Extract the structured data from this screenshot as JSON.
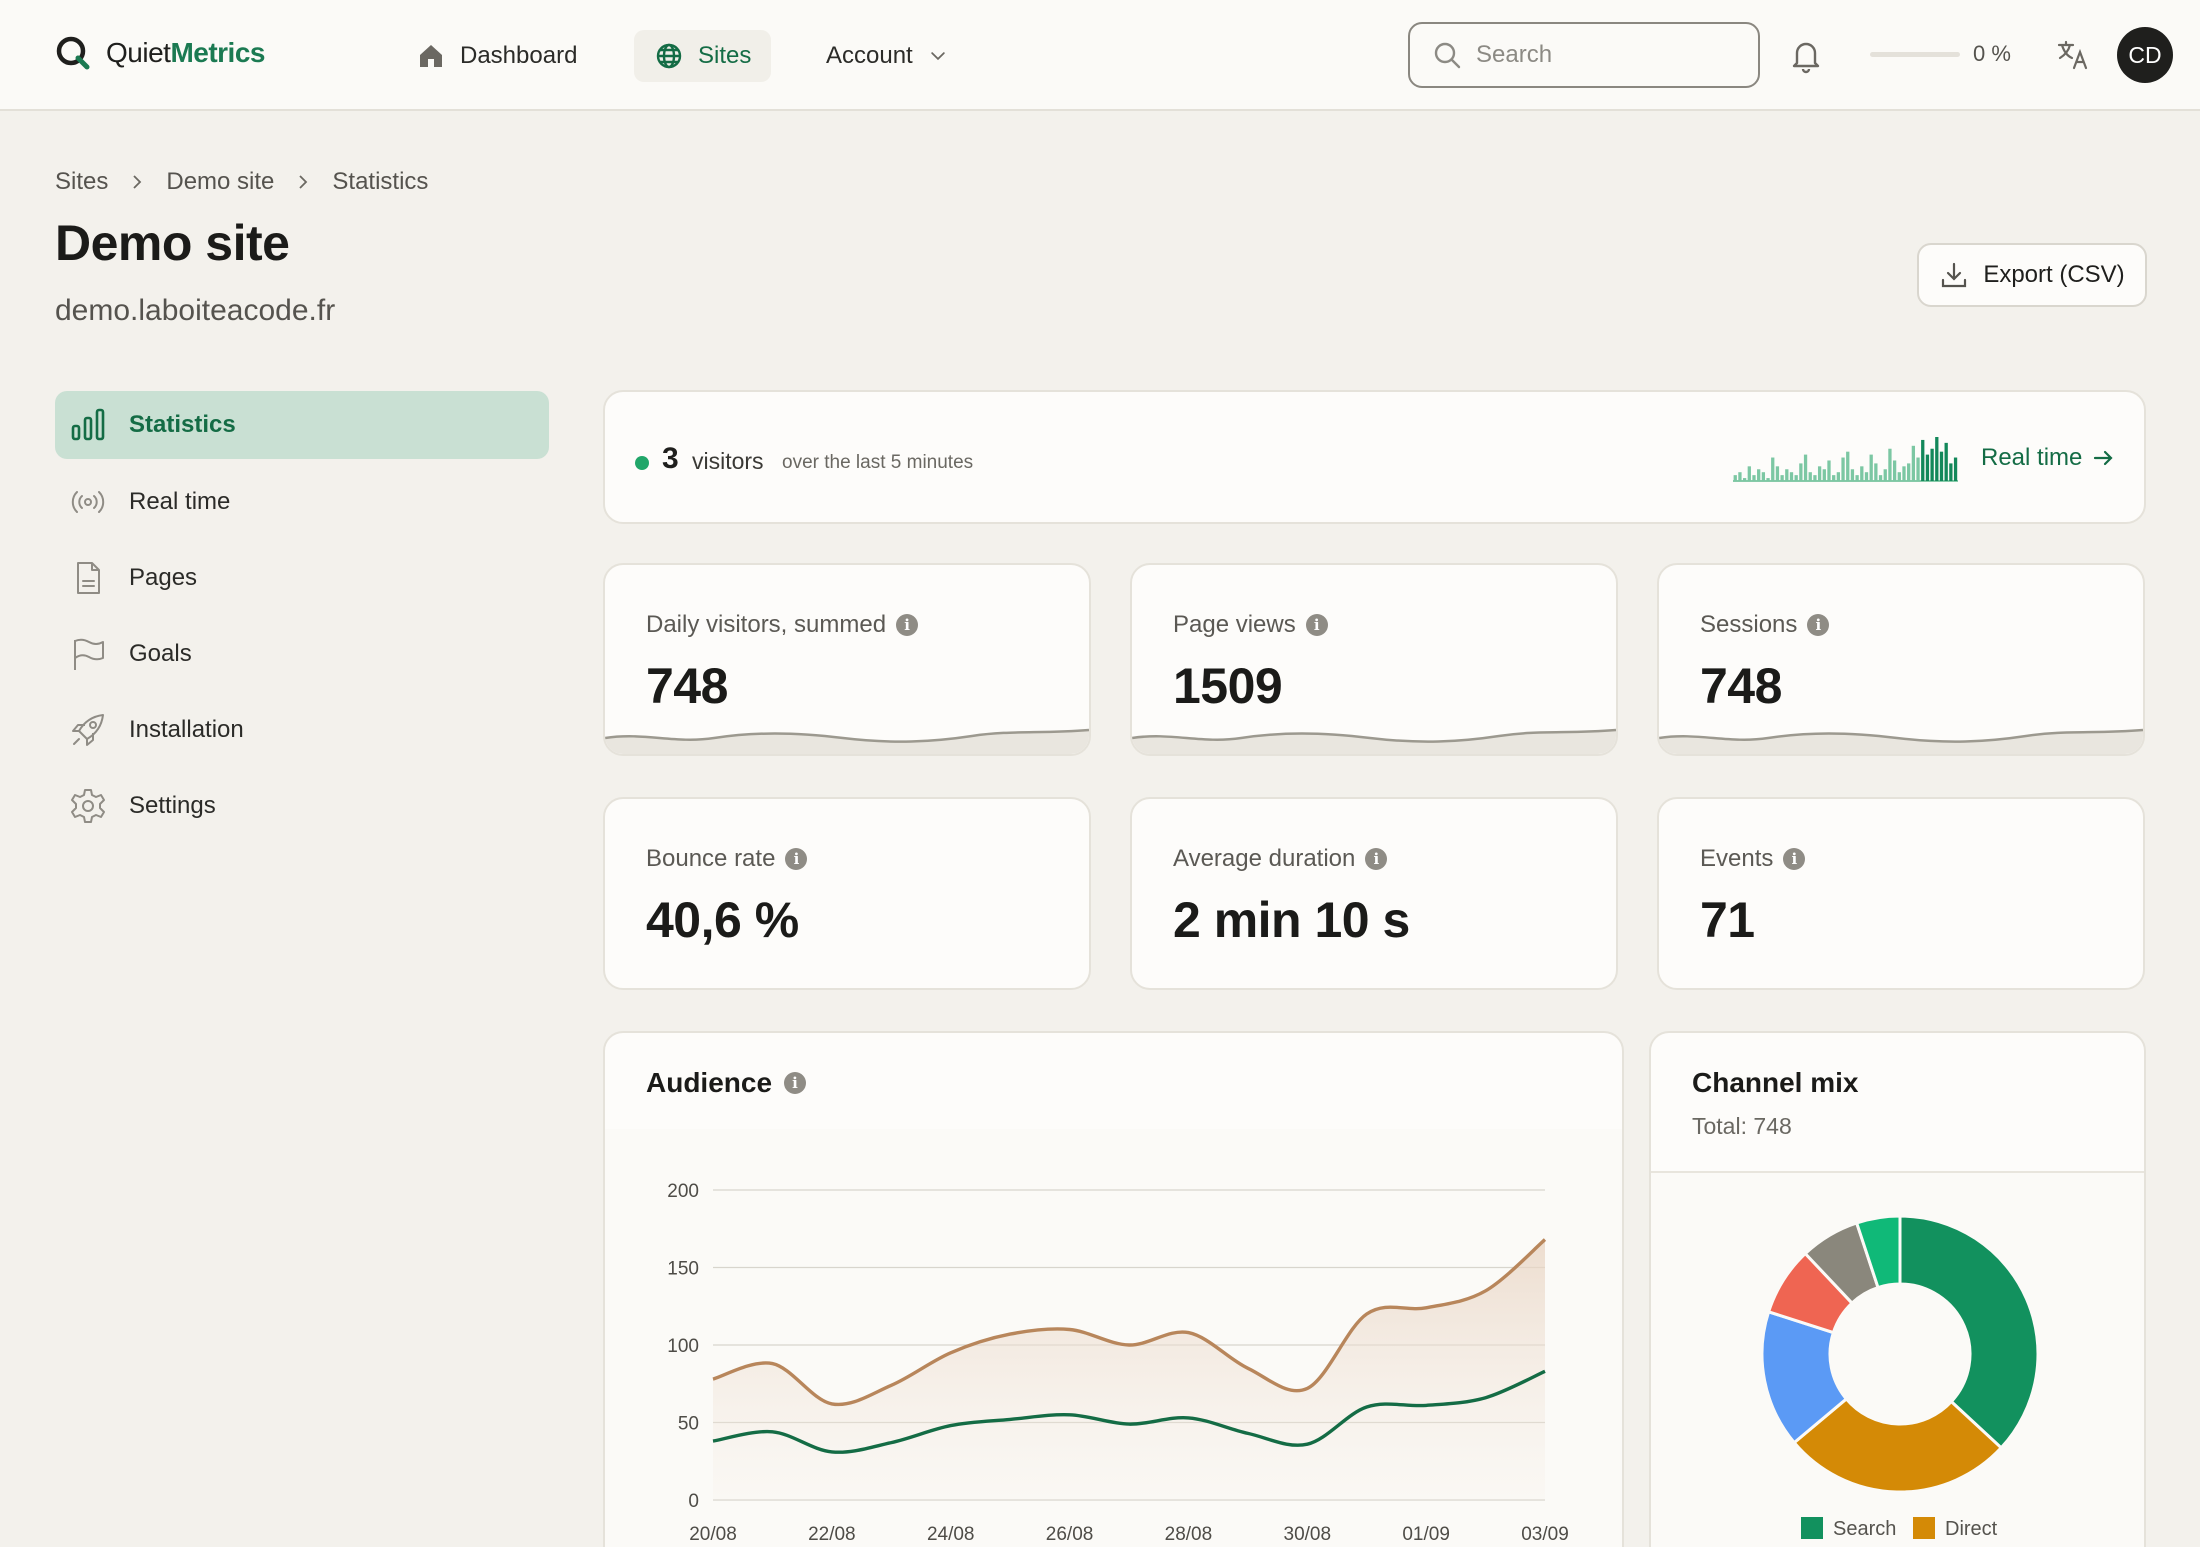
{
  "brand": {
    "name_part1": "Quiet",
    "name_part2": "Metrics",
    "accent": "#1b7a52"
  },
  "nav": {
    "dashboard": "Dashboard",
    "sites": "Sites",
    "account": "Account"
  },
  "search": {
    "placeholder": "Search"
  },
  "usage": {
    "percent": 0,
    "label": "0 %"
  },
  "user": {
    "initials": "CD"
  },
  "breadcrumb": [
    "Sites",
    "Demo site",
    "Statistics"
  ],
  "page": {
    "title": "Demo site",
    "domain": "demo.laboiteacode.fr"
  },
  "actions": {
    "export": "Export (CSV)"
  },
  "sidebar": [
    {
      "label": "Statistics",
      "icon": "bar-chart-icon",
      "active": true
    },
    {
      "label": "Real time",
      "icon": "broadcast-icon",
      "active": false
    },
    {
      "label": "Pages",
      "icon": "document-icon",
      "active": false
    },
    {
      "label": "Goals",
      "icon": "flag-icon",
      "active": false
    },
    {
      "label": "Installation",
      "icon": "rocket-icon",
      "active": false
    },
    {
      "label": "Settings",
      "icon": "gear-icon",
      "active": false
    }
  ],
  "realtime": {
    "count": "3",
    "label": "visitors",
    "sub": "over the last 5 minutes",
    "link": "Real time",
    "bars": [
      2,
      3,
      1,
      5,
      2,
      4,
      3,
      1,
      8,
      5,
      2,
      4,
      3,
      2,
      6,
      9,
      3,
      2,
      5,
      4,
      7,
      2,
      3,
      8,
      10,
      4,
      2,
      5,
      3,
      9,
      6,
      2,
      4,
      11,
      7,
      3,
      5,
      6,
      12,
      8,
      14,
      9,
      11,
      15,
      10,
      13,
      6,
      8
    ],
    "status_color": "#21a669"
  },
  "stats": [
    {
      "label": "Daily visitors, summed",
      "value": "748",
      "spark": true
    },
    {
      "label": "Page views",
      "value": "1509",
      "spark": true
    },
    {
      "label": "Sessions",
      "value": "748",
      "spark": true
    },
    {
      "label": "Bounce rate",
      "value": "40,6 %",
      "spark": false
    },
    {
      "label": "Average duration",
      "value": "2 min 10 s",
      "spark": false
    },
    {
      "label": "Events",
      "value": "71",
      "spark": false
    }
  ],
  "audience": {
    "title": "Audience",
    "chart_data": {
      "type": "area",
      "ylim": [
        0,
        200
      ],
      "yticks": [
        0,
        50,
        100,
        150,
        200
      ],
      "x": [
        "20/08",
        "21/08",
        "22/08",
        "23/08",
        "24/08",
        "25/08",
        "26/08",
        "27/08",
        "28/08",
        "29/08",
        "30/08",
        "31/08",
        "01/09",
        "02/09",
        "03/09"
      ],
      "xtick_labels": [
        "20/08",
        "22/08",
        "24/08",
        "26/08",
        "28/08",
        "30/08",
        "01/09",
        "03/09"
      ],
      "series": [
        {
          "color": "#b8865b",
          "values": [
            78,
            88,
            62,
            74,
            95,
            107,
            110,
            100,
            108,
            85,
            72,
            120,
            124,
            135,
            168
          ]
        },
        {
          "color": "#146c45",
          "values": [
            38,
            44,
            31,
            37,
            48,
            52,
            55,
            49,
            53,
            43,
            36,
            60,
            61,
            66,
            83
          ]
        }
      ]
    }
  },
  "channel": {
    "title": "Channel mix",
    "total": "Total: 748",
    "chart_data": {
      "type": "pie",
      "slices": [
        {
          "name": "Search",
          "value": 276,
          "color": "#12915e"
        },
        {
          "name": "Direct",
          "value": 202,
          "color": "#d48a06"
        },
        {
          "name": "",
          "value": 120,
          "color": "#5b9af5"
        },
        {
          "name": "",
          "value": 60,
          "color": "#ef6552"
        },
        {
          "name": "",
          "value": 52,
          "color": "#8a877c"
        },
        {
          "name": "",
          "value": 38,
          "color": "#10b978"
        }
      ],
      "legend": [
        "Search",
        "Direct"
      ]
    }
  }
}
